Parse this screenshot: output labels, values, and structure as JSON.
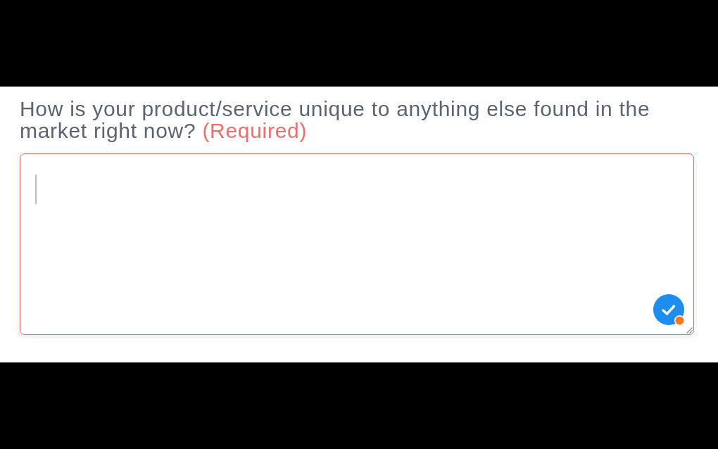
{
  "question": {
    "text": "How is your product/service unique to anything else found in the market right now?",
    "required_label": "(Required)"
  },
  "answer": {
    "focused": true,
    "invalid": true,
    "resizable": true
  },
  "assistant_badge": {
    "alert": true
  }
}
